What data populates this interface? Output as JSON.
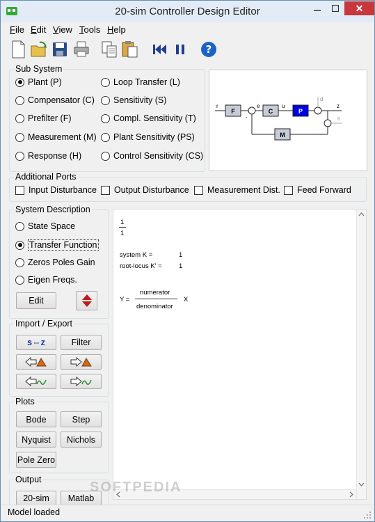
{
  "window": {
    "title": "20-sim Controller Design Editor",
    "close_glyph": "✕"
  },
  "menu": [
    {
      "u": "F",
      "rest": "ile"
    },
    {
      "u": "E",
      "rest": "dit"
    },
    {
      "u": "V",
      "rest": "iew"
    },
    {
      "u": "T",
      "rest": "ools"
    },
    {
      "u": "H",
      "rest": "elp"
    }
  ],
  "toolbar_icons": [
    "new-file-icon",
    "open-folder-icon",
    "save-icon",
    "print-icon",
    "copy-icon",
    "paste-icon",
    "rewind-icon",
    "pause-icon",
    "help-icon"
  ],
  "subsystem": {
    "label": "Sub System",
    "left": [
      "Plant (P)",
      "Compensator (C)",
      "Prefilter (F)",
      "Measurement (M)",
      "Response (H)"
    ],
    "right": [
      "Loop Transfer (L)",
      "Sensitivity (S)",
      "Compl. Sensitivity (T)",
      "Plant Sensitivity (PS)",
      "Control Sensitivity (CS)"
    ],
    "selected": "Plant (P)"
  },
  "diagram": {
    "signals": [
      "r",
      "e",
      "u",
      "z",
      "d",
      "n"
    ],
    "blocks": [
      "F",
      "C",
      "P",
      "M"
    ],
    "minus_sign": "-",
    "highlight_color": "#0000e0"
  },
  "ports": {
    "label": "Additional Ports",
    "items": [
      "Input Disturbance",
      "Output Disturbance",
      "Measurement Dist.",
      "Feed Forward"
    ]
  },
  "sysdesc": {
    "label": "System Description",
    "options": [
      "State Space",
      "Transfer Function",
      "Zeros Poles Gain",
      "Eigen Freqs."
    ],
    "selected": "Transfer Function",
    "edit_label": "Edit"
  },
  "importexport": {
    "label": "Import / Export",
    "sz_label": "s⇔z",
    "filter_label": "Filter"
  },
  "plots": {
    "label": "Plots",
    "buttons": [
      "Bode",
      "Step",
      "Nyquist",
      "Nichols",
      "Pole Zero"
    ]
  },
  "output": {
    "label": "Output",
    "buttons": [
      "20-sim",
      "Matlab"
    ]
  },
  "content": {
    "frac_num": "1",
    "frac_den": "1",
    "k_label": "system K  =",
    "k_value": "1",
    "rk_label": "root-locus K'  =",
    "rk_value": "1",
    "y_label": "Y  =",
    "y_num": "numerator",
    "y_den": "denominator",
    "y_x": "X"
  },
  "status": "Model loaded",
  "watermark": "SOFTPEDIA"
}
